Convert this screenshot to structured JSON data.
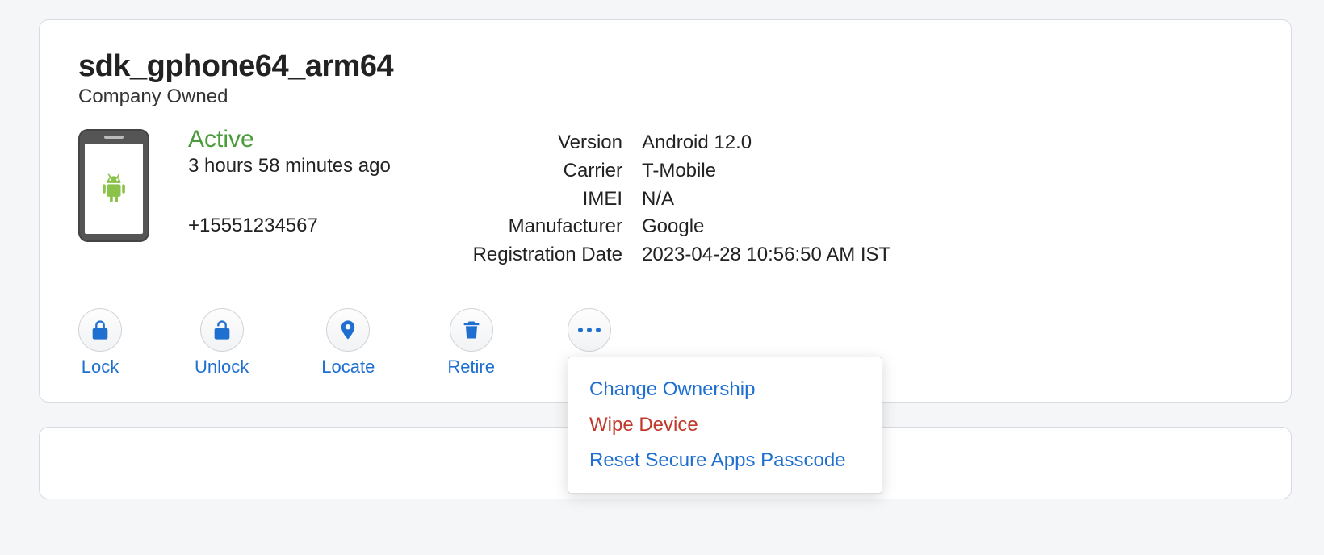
{
  "device": {
    "name": "sdk_gphone64_arm64",
    "ownership": "Company Owned",
    "status": "Active",
    "last_seen": "3 hours 58 minutes ago",
    "phone": "+15551234567"
  },
  "info": {
    "version_label": "Version",
    "version_value": "Android 12.0",
    "carrier_label": "Carrier",
    "carrier_value": "T-Mobile",
    "imei_label": "IMEI",
    "imei_value": "N/A",
    "manufacturer_label": "Manufacturer",
    "manufacturer_value": "Google",
    "registration_label": "Registration Date",
    "registration_value": "2023-04-28 10:56:50 AM IST"
  },
  "actions": {
    "lock": "Lock",
    "unlock": "Unlock",
    "locate": "Locate",
    "retire": "Retire"
  },
  "menu": {
    "change_ownership": "Change Ownership",
    "wipe_device": "Wipe Device",
    "reset_passcode": "Reset Secure Apps Passcode"
  }
}
